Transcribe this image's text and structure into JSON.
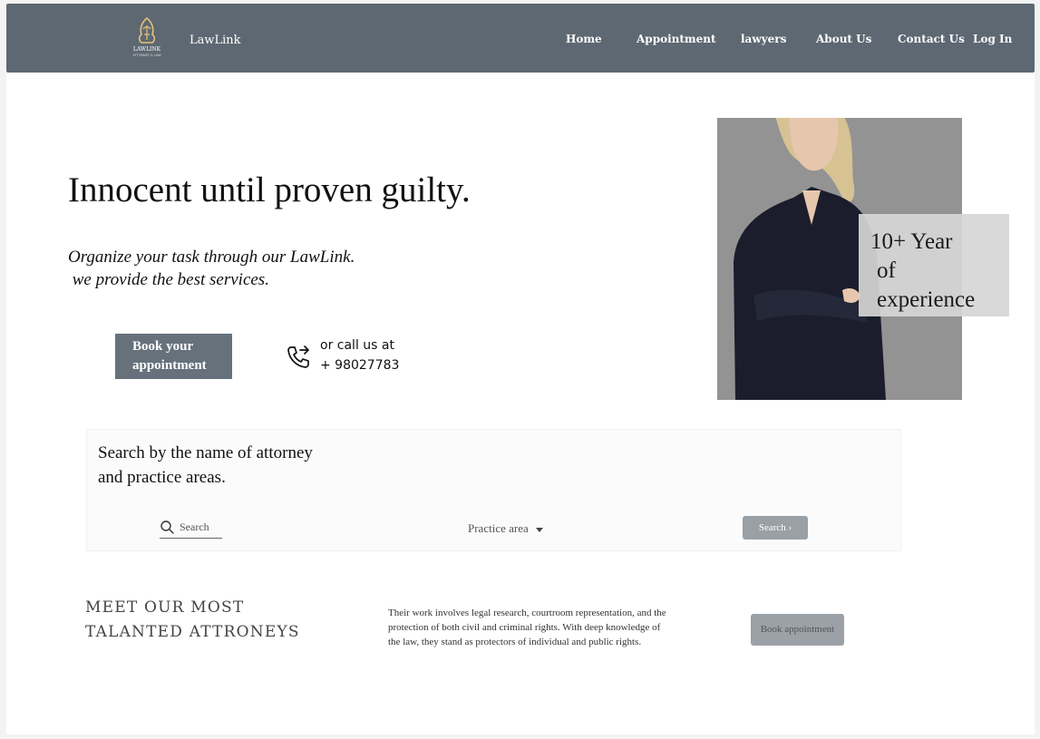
{
  "brand": {
    "name": "LawLink",
    "logo_text": "LAWLINK",
    "logo_subtext": "ATTORNEY & LAW"
  },
  "nav": {
    "items": [
      "Home",
      "Appointment",
      "lawyers",
      "About Us",
      "Contact Us",
      "Log In"
    ]
  },
  "hero": {
    "headline": "Innocent until proven guilty.",
    "subtitle_lines": [
      "Organize your task through our LawLink.",
      " we provide the best services."
    ],
    "book_button_lines": [
      "Book your",
      "appointment"
    ],
    "call_lines": [
      "or call us at",
      "+ 98027783"
    ],
    "experience_lines": [
      "10+ Year",
      "of",
      "experience"
    ]
  },
  "search": {
    "title_lines": [
      "Search by the name of attorney",
      "and practice areas."
    ],
    "input_placeholder": "Search",
    "practice_area_label": "Practice area",
    "button_label": "Search ›"
  },
  "attorneys": {
    "title_lines": [
      "MEET OUR MOST",
      "TALANTED ATTRONEYS"
    ],
    "description_lines": [
      "Their work involves legal research, courtroom representation, and the",
      "protection of both civil and criminal rights. With deep knowledge of",
      "the law, they stand as protectors of individual and public rights."
    ],
    "button_label": "Book appointment"
  },
  "colors": {
    "navbar": "#5d6872",
    "primary_button": "#66717b",
    "secondary_button": "#99a0a6",
    "hero_background": "#939393",
    "experience_overlay": "#d6d6d6"
  },
  "icons": {
    "logo": "lion-law-logo",
    "phone": "phone-forward-icon",
    "search": "search-icon",
    "dropdown": "caret-down-icon",
    "hero_person": "attorney-portrait"
  }
}
